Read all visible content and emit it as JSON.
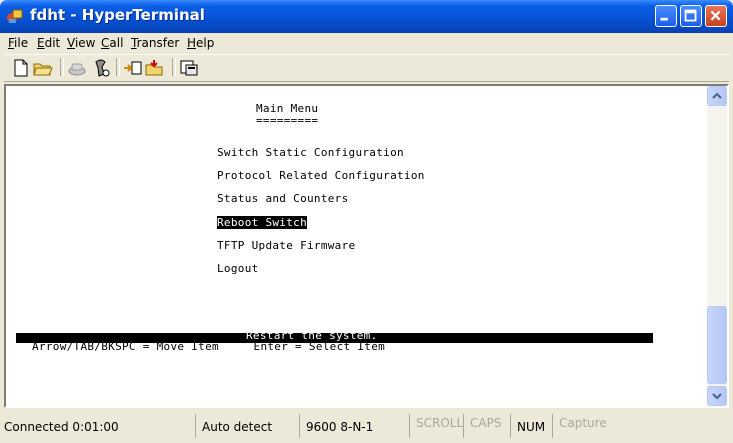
{
  "window": {
    "title": "fdht - HyperTerminal"
  },
  "menu": [
    {
      "pre": "",
      "acc": "F",
      "post": "ile"
    },
    {
      "pre": "",
      "acc": "E",
      "post": "dit"
    },
    {
      "pre": "",
      "acc": "V",
      "post": "iew"
    },
    {
      "pre": "",
      "acc": "C",
      "post": "all"
    },
    {
      "pre": "",
      "acc": "T",
      "post": "ransfer"
    },
    {
      "pre": "",
      "acc": "H",
      "post": "elp"
    }
  ],
  "toolbar": {
    "icons": [
      "new-icon",
      "open-icon",
      "connect-icon",
      "disconnect-icon",
      "send-icon",
      "receive-icon",
      "properties-icon"
    ]
  },
  "terminal": {
    "title": "Main Menu",
    "underline": "=========",
    "items": [
      "Switch Static Configuration",
      "Protocol Related Configuration",
      "Status and Counters",
      "Reboot Switch",
      "TFTP Update Firmware",
      "Logout"
    ],
    "selected_index": 3,
    "status_message": "Restart the system.",
    "help_text": "Arrow/TAB/BKSPC = Move Item     Enter = Select Item"
  },
  "statusbar": {
    "connected": "Connected 0:01:00",
    "detect": "Auto detect",
    "settings": "9600 8-N-1",
    "scroll": "SCROLL",
    "caps": "CAPS",
    "num": "NUM",
    "capture": "Capture"
  },
  "colors": {
    "titlebar": "#0653d6",
    "close_button": "#c9401e",
    "selection_bg": "#000000",
    "selection_fg": "#ffffff",
    "window_bg": "#ece9d8"
  }
}
